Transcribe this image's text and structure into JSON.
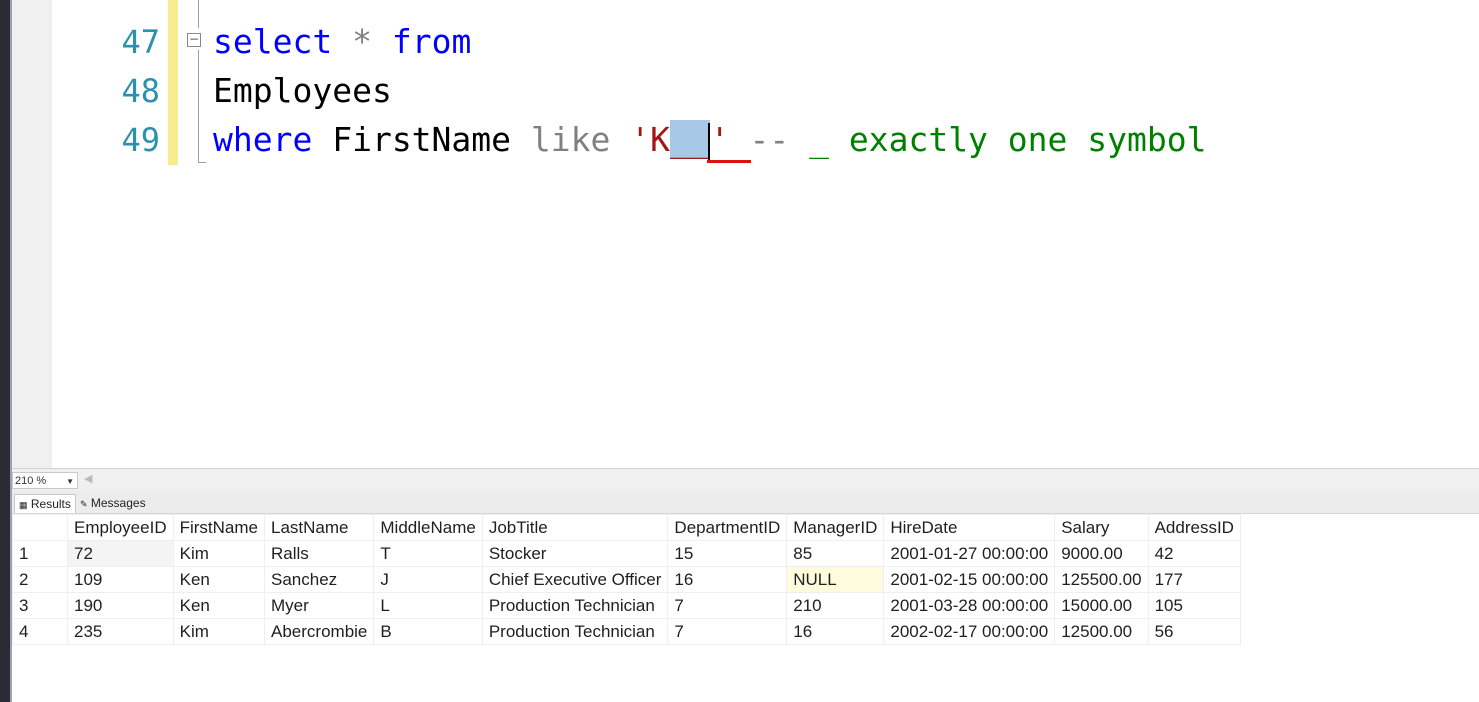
{
  "editor": {
    "lines": [
      {
        "num": "47",
        "tokens": [
          {
            "t": "select",
            "c": "kw"
          },
          {
            "t": " "
          },
          {
            "t": "*",
            "c": "op"
          },
          {
            "t": " "
          },
          {
            "t": "from",
            "c": "kw"
          }
        ]
      },
      {
        "num": "48",
        "tokens": [
          {
            "t": "Employees"
          }
        ]
      },
      {
        "num": "49",
        "tokens": [
          {
            "t": "where",
            "c": "kw"
          },
          {
            "t": " FirstName "
          },
          {
            "t": "like",
            "c": "op"
          },
          {
            "t": " "
          },
          {
            "t": "'K",
            "c": "str"
          },
          {
            "t": "__",
            "c": "str sel"
          },
          {
            "t": "CARET"
          },
          {
            "t": "'",
            "c": "str"
          },
          {
            "t": " "
          },
          {
            "t": "--",
            "c": "op"
          },
          {
            "t": " _ exactly one symbol",
            "c": "cmt"
          }
        ]
      }
    ]
  },
  "zoom": {
    "value": "210 %"
  },
  "tabs": {
    "results": "Results",
    "messages": "Messages"
  },
  "results": {
    "columns": [
      "EmployeeID",
      "FirstName",
      "LastName",
      "MiddleName",
      "JobTitle",
      "DepartmentID",
      "ManagerID",
      "HireDate",
      "Salary",
      "AddressID"
    ],
    "rows": [
      [
        "1",
        "72",
        "Kim",
        "Ralls",
        "T",
        "Stocker",
        "15",
        "85",
        "2001-01-27 00:00:00",
        "9000.00",
        "42"
      ],
      [
        "2",
        "109",
        "Ken",
        "Sanchez",
        "J",
        "Chief Executive Officer",
        "16",
        "NULL",
        "2001-02-15 00:00:00",
        "125500.00",
        "177"
      ],
      [
        "3",
        "190",
        "Ken",
        "Myer",
        "L",
        "Production Technician",
        "7",
        "210",
        "2001-03-28 00:00:00",
        "15000.00",
        "105"
      ],
      [
        "4",
        "235",
        "Kim",
        "Abercrombie",
        "B",
        "Production Technician",
        "7",
        "16",
        "2002-02-17 00:00:00",
        "12500.00",
        "56"
      ]
    ]
  }
}
